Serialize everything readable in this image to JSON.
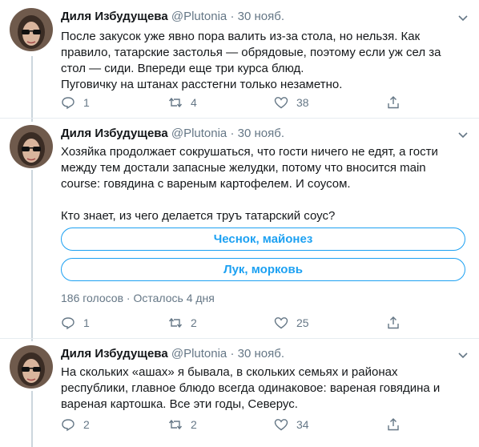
{
  "tweets": [
    {
      "name": "Диля Избудущева",
      "handle": "@Plutonia",
      "date": "30 нояб.",
      "lines": [
        "После закусок уже явно пора валить из-за стола, но нельзя. Как",
        "правило, татарские застолья — обрядовые, поэтому если уж сел за",
        "стол — сиди. Впереди еще три курса блюд.",
        "Пуговичку на штанах расстегни только незаметно."
      ],
      "replies": "1",
      "retweets": "4",
      "likes": "38"
    },
    {
      "name": "Диля Избудущева",
      "handle": "@Plutonia",
      "date": "30 нояб.",
      "lines": [
        "Хозяйка продолжает сокрушаться, что гости ничего не едят, а гости",
        "между тем достали запасные желудки, потому что вносится main",
        "course: говядина с вареным картофелем. И соусом.",
        "Кто знает, из чего делается труъ татарский соус?"
      ],
      "poll": {
        "options": [
          "Чеснок, майонез",
          "Лук, морковь"
        ],
        "votes": "186 голосов",
        "sep": "·",
        "remaining": "Осталось 4 дня"
      },
      "replies": "1",
      "retweets": "2",
      "likes": "25"
    },
    {
      "name": "Диля Избудущева",
      "handle": "@Plutonia",
      "date": "30 нояб.",
      "lines": [
        "На скольких «ашах» я бывала, в скольких семьях и районах",
        "республики, главное блюдо всегда одинаковое: вареная говядина и",
        "вареная картошка. Все эти годы, Северус."
      ],
      "replies": "2",
      "retweets": "2",
      "likes": "34"
    }
  ],
  "colors": {
    "accent": "#1da1f2",
    "text": "#14171a",
    "muted": "#657786",
    "thread_line": "#ccd6dd",
    "divider": "#e6ecf0"
  },
  "icons": [
    "reply-icon",
    "retweet-icon",
    "like-icon",
    "share-icon",
    "chevron-down-icon"
  ]
}
